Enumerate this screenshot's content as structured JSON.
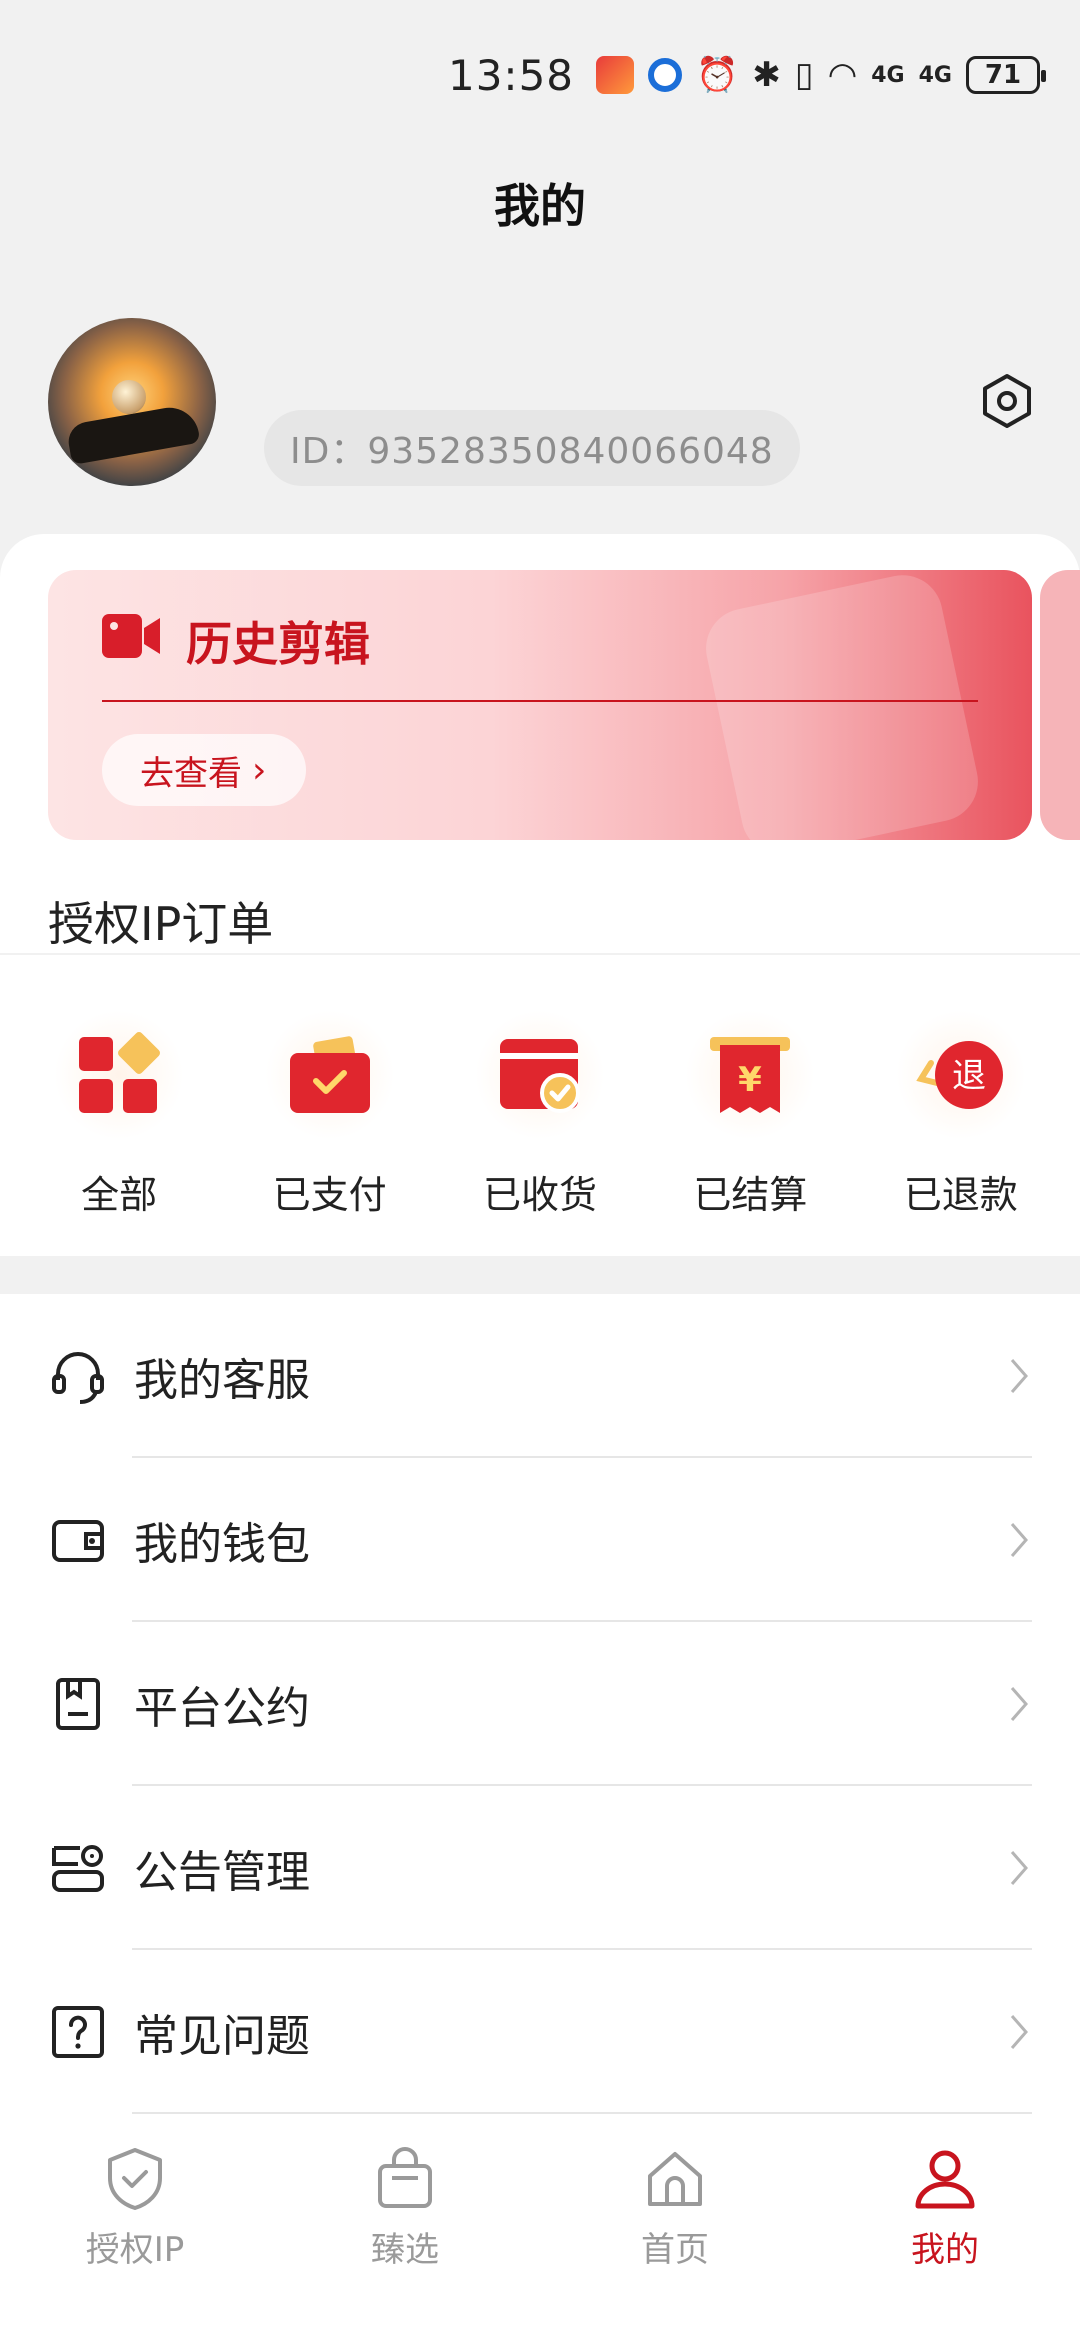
{
  "status_bar": {
    "time": "13:58",
    "signal1": "4G",
    "signal2": "4G",
    "battery": "71"
  },
  "header": {
    "title": "我的"
  },
  "profile": {
    "id_text": "ID：93528350840066048"
  },
  "history": {
    "title": "历史剪辑",
    "button_label": "去查看"
  },
  "orders": {
    "title": "授权IP订单",
    "items": [
      {
        "label": "全部",
        "icon": "grid-icon"
      },
      {
        "label": "已支付",
        "icon": "wallet-check-icon"
      },
      {
        "label": "已收货",
        "icon": "card-check-icon"
      },
      {
        "label": "已结算",
        "icon": "receipt-yen-icon"
      },
      {
        "label": "已退款",
        "icon": "refund-icon",
        "icon_text": "退"
      }
    ],
    "yen": "¥"
  },
  "menu": {
    "items": [
      {
        "label": "我的客服",
        "icon": "headset-icon"
      },
      {
        "label": "我的钱包",
        "icon": "wallet-icon"
      },
      {
        "label": "平台公约",
        "icon": "document-icon"
      },
      {
        "label": "公告管理",
        "icon": "announcement-icon"
      },
      {
        "label": "常见问题",
        "icon": "question-icon"
      }
    ]
  },
  "bottom_nav": {
    "items": [
      {
        "label": "授权IP",
        "icon": "shield-icon",
        "active": false
      },
      {
        "label": "臻选",
        "icon": "bag-icon",
        "active": false
      },
      {
        "label": "首页",
        "icon": "home-icon",
        "active": false
      },
      {
        "label": "我的",
        "icon": "user-icon",
        "active": true
      }
    ]
  },
  "colors": {
    "accent": "#c8141e",
    "background": "#f1f1f1",
    "inactive_nav": "#9a9a9a"
  }
}
